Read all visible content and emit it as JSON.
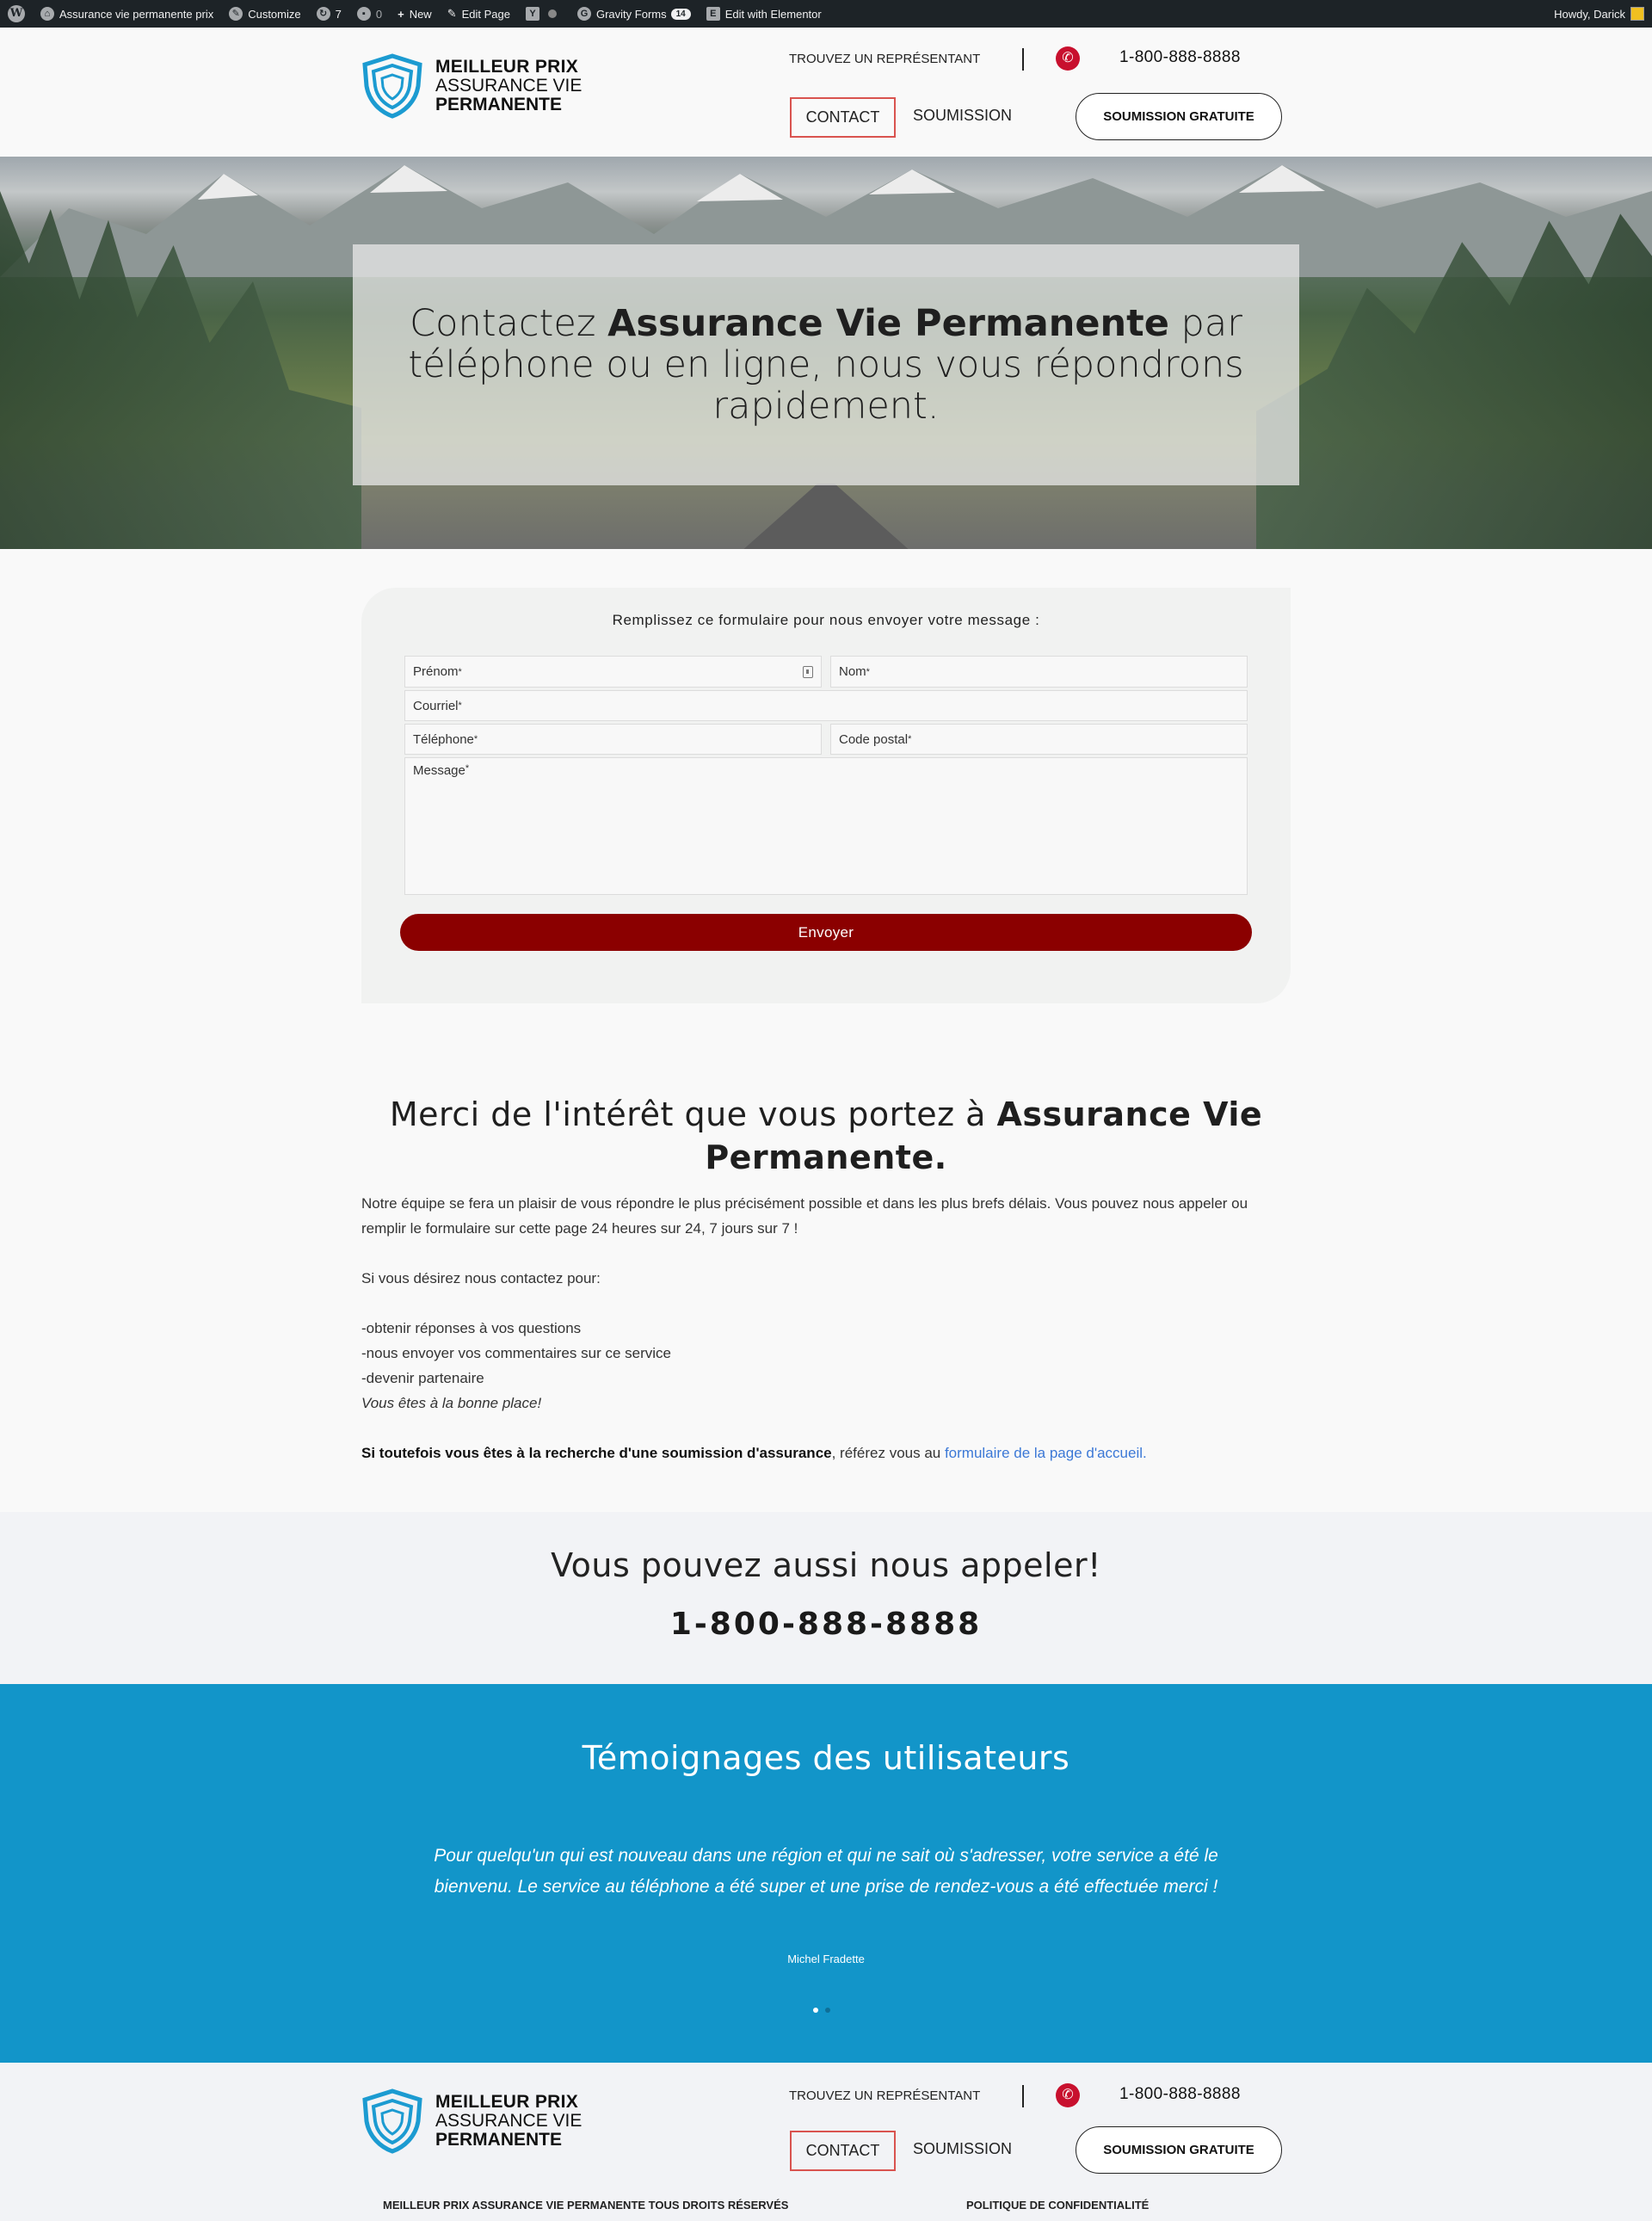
{
  "admin_bar": {
    "site_name": "Assurance vie permanente prix",
    "customize": "Customize",
    "updates_count": "7",
    "comments_count": "0",
    "new": "New",
    "edit_page": "Edit Page",
    "gravity_forms": "Gravity Forms",
    "gravity_forms_badge": "14",
    "elementor": "Edit with Elementor",
    "greeting": "Howdy, Darick"
  },
  "brand": {
    "line1": "MEILLEUR PRIX",
    "line2": "ASSURANCE VIE",
    "line3": "PERMANENTE",
    "shield_color": "#1c9bd1"
  },
  "header": {
    "find_rep": "TROUVEZ UN REPRÉSENTANT",
    "phone": "1-800-888-8888",
    "nav_contact": "CONTACT",
    "nav_soumission": "SOUMISSION",
    "cta": "SOUMISSION GRATUITE"
  },
  "hero": {
    "pre": "Contactez ",
    "bold": "Assurance Vie Permanente",
    "post": " par téléphone ou en ligne, nous vous répondrons rapidement."
  },
  "form": {
    "title": "Remplissez ce formulaire pour nous envoyer votre message :",
    "prenom": "Prénom",
    "nom": "Nom",
    "courriel": "Courriel",
    "telephone": "Téléphone",
    "code_postal": "Code postal",
    "message": "Message",
    "required_mark": "*",
    "submit": "Envoyer",
    "submit_color": "#8b0000"
  },
  "thanks": {
    "title_pre": "Merci de l'intérêt que vous portez à ",
    "title_bold": "Assurance Vie Permanente.",
    "p1": "Notre équipe se fera un plaisir de vous répondre le plus précisément possible et dans les plus brefs délais. Vous pouvez nous appeler ou remplir le formulaire sur cette page 24 heures sur 24, 7 jours sur 7 !",
    "p2": "Si vous désirez nous contactez pour:",
    "item1": "-obtenir réponses à vos questions",
    "item2": "-nous envoyer vos commentaires sur ce service",
    "item3": "-devenir partenaire",
    "italic": "Vous êtes à la bonne place!",
    "p3_bold": "Si toutefois vous êtes à la recherche d'une soumission d'assurance",
    "p3_mid": ", référez vous au ",
    "p3_link": "formulaire de la page d'accueil."
  },
  "call": {
    "title": "Vous pouvez aussi nous appeler!",
    "phone": "1-800-888-8888"
  },
  "testimonials": {
    "title": "Témoignages des utilisateurs",
    "quote": "Pour quelqu'un qui est nouveau dans une région et qui ne sait où s'adresser, votre service a été le bienvenu. Le service au téléphone a été super et une prise de rendez-vous a été effectuée merci !",
    "author": "Michel Fradette",
    "bg_color": "#1295c9"
  },
  "footer": {
    "copyright": "MEILLEUR PRIX ASSURANCE VIE PERMANENTE TOUS DROITS RÉSERVÉS",
    "privacy": "POLITIQUE DE CONFIDENTIALITÉ"
  }
}
